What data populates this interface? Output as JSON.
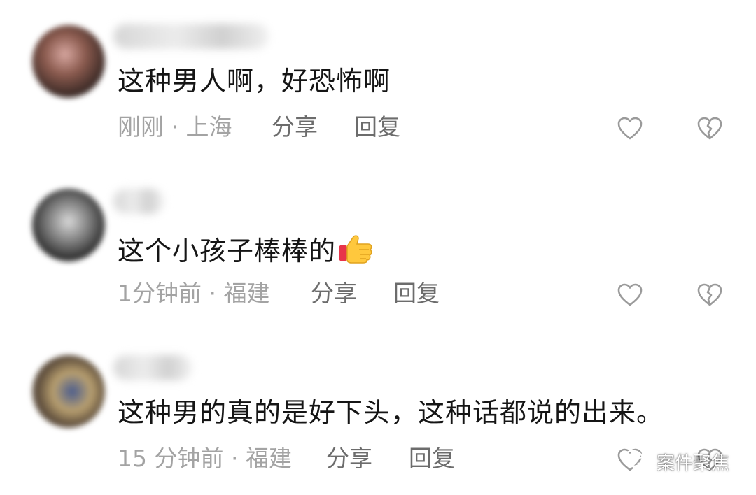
{
  "comments": [
    {
      "text": "这种男人啊，好恐怖啊",
      "meta": "刚刚 · 上海",
      "share_label": "分享",
      "reply_label": "回复"
    },
    {
      "text": "这个小孩子棒棒的",
      "emoji": "thumbs-up-emoji",
      "meta": "1分钟前 · 福建",
      "share_label": "分享",
      "reply_label": "回复"
    },
    {
      "text": "这种男的真的是好下头，这种话都说的出来。",
      "meta": "15 分钟前 · 福建",
      "share_label": "分享",
      "reply_label": "回复"
    }
  ],
  "icons": {
    "like": "heart-outline-icon",
    "dislike": "broken-heart-outline-icon"
  },
  "watermark": {
    "text": "案件聚焦",
    "icon": "wechat-icon"
  },
  "colors": {
    "meta_text": "#a3a3a3",
    "action_text": "#6c6c6c",
    "icon_stroke": "#9a9a9a",
    "comment_text": "#151515"
  }
}
